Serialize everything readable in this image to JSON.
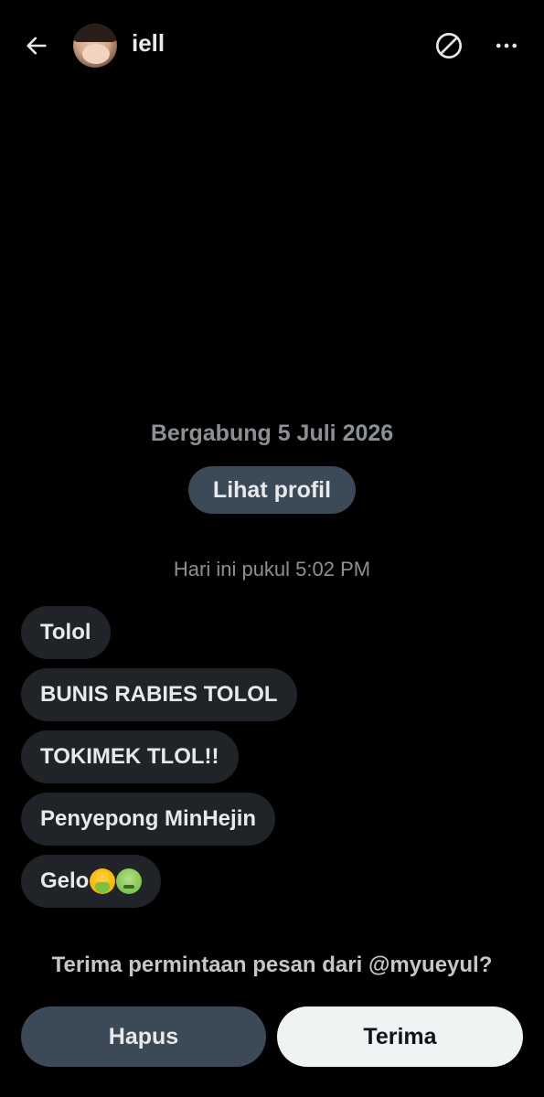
{
  "header": {
    "name": "iell",
    "back_icon": "arrow-left-icon",
    "block_icon": "block-icon",
    "more_icon": "more-horizontal-icon"
  },
  "profile": {
    "joined_text": "Bergabung 5 Juli 2026",
    "view_profile_label": "Lihat profil"
  },
  "conversation": {
    "timestamp": "Hari ini pukul 5:02 PM",
    "messages": [
      {
        "text": "Tolol"
      },
      {
        "text": "BUNIS RABIES TOLOL"
      },
      {
        "text": "TOKIMEK TLOL!!"
      },
      {
        "text": "Penyepong MinHejin"
      },
      {
        "text": "Gelo",
        "emojis": [
          "face-vomiting-emoji",
          "nauseated-face-emoji"
        ]
      }
    ]
  },
  "request": {
    "prompt": "Terima permintaan pesan dari @myueyul?",
    "delete_label": "Hapus",
    "accept_label": "Terima"
  },
  "colors": {
    "background": "#000000",
    "bubble": "#202327",
    "secondary_button": "#3c4a57",
    "primary_button": "#eff3f4",
    "muted_text": "#8b9095"
  }
}
